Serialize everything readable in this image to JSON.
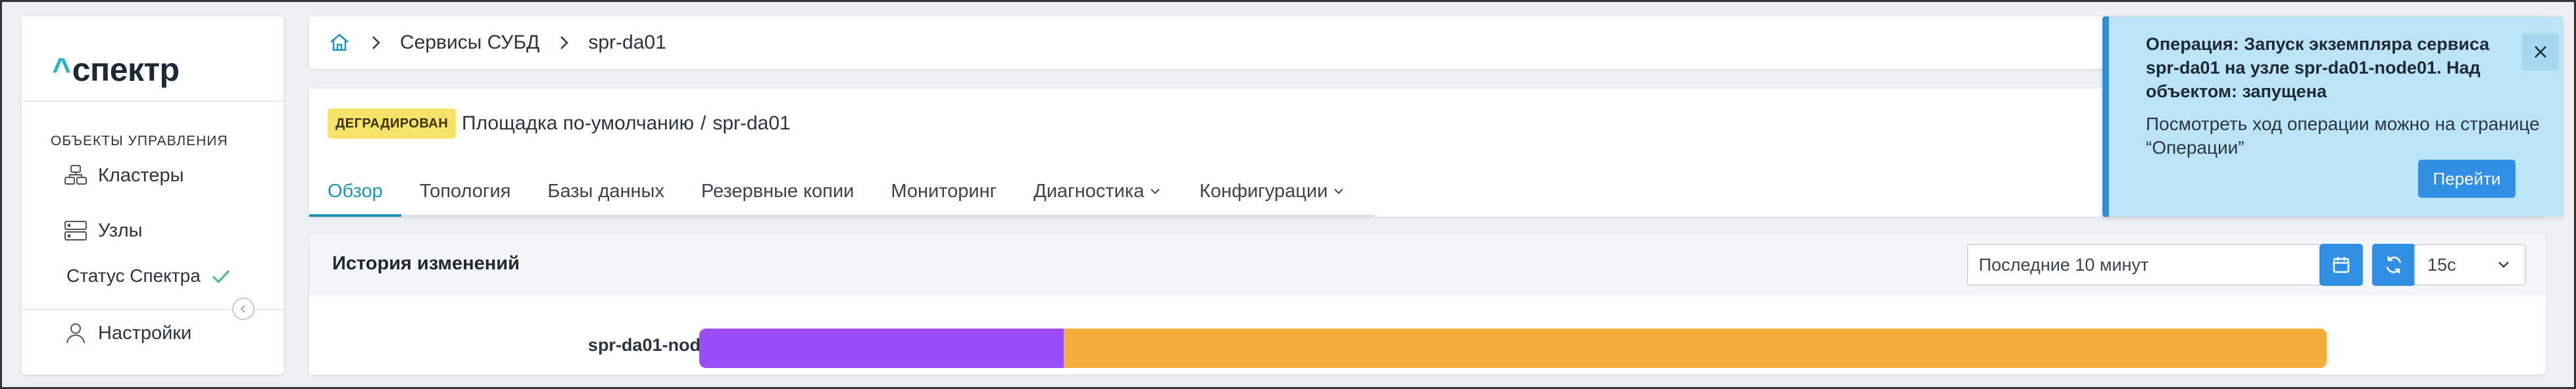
{
  "sidebar": {
    "logo_caret": "^",
    "logo_text": "спектр",
    "section_title": "ОБЪЕКТЫ УПРАВЛЕНИЯ",
    "items": [
      {
        "label": "Кластеры",
        "icon": "cluster-icon"
      },
      {
        "label": "Узлы",
        "icon": "server-icon"
      }
    ],
    "status_label": "Статус Спектра",
    "settings_label": "Настройки"
  },
  "breadcrumb": {
    "items": [
      "Сервисы СУБД",
      "spr-da01"
    ]
  },
  "header": {
    "status_badge": "ДЕГРАДИРОВАН",
    "path_site": "Площадка по-умолчанию",
    "path_sep": "/",
    "path_service": "spr-da01"
  },
  "tabs": [
    {
      "label": "Обзор",
      "active": true
    },
    {
      "label": "Топология"
    },
    {
      "label": "Базы данных"
    },
    {
      "label": "Резервные копии"
    },
    {
      "label": "Мониторинг"
    },
    {
      "label": "Диагностика",
      "dropdown": true
    },
    {
      "label": "Конфигурации",
      "dropdown": true
    }
  ],
  "history": {
    "title": "История изменений",
    "time_range": "Последние 10 минут",
    "interval": "15с",
    "node": "spr-da01-node01",
    "segments": [
      {
        "fraction": 0.224,
        "color": "#9b4dfa"
      },
      {
        "fraction": 0.776,
        "color": "#f5ad3a"
      }
    ]
  },
  "toast": {
    "title": "Операция: Запуск экземпляра сервиса spr-da01 на узле spr-da01-node01. Над объектом: запущена",
    "body": "Посмотреть ход операции можно на странице “Операции”",
    "button": "Перейти"
  },
  "colors": {
    "accent": "#1895b9",
    "primary_button": "#2f8fe4",
    "badge": "#f8e36a",
    "toast_bg": "#bce4f8"
  }
}
